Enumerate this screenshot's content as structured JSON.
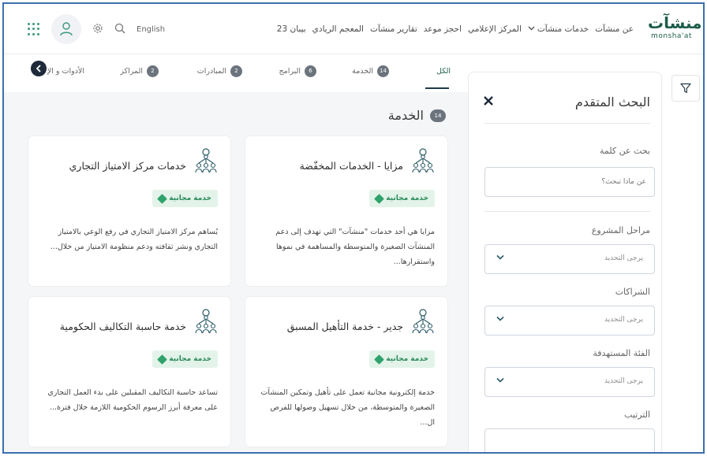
{
  "header": {
    "logo_ar": "منشآت",
    "logo_en": "monsha'at",
    "nav": [
      "عن منشآت",
      "خدمات منشآت",
      "المركز الإعلامي",
      "احجز موعد",
      "تقارير منشآت",
      "المعجم الريادي",
      "بيبان 23"
    ],
    "language": "English"
  },
  "tabs": [
    {
      "label": "الكل",
      "count": ""
    },
    {
      "label": "الخدمة",
      "count": "14"
    },
    {
      "label": "البرامج",
      "count": "6"
    },
    {
      "label": "المبادرات",
      "count": "2"
    },
    {
      "label": "المراكز",
      "count": "2"
    },
    {
      "label": "الأدوات و الإ",
      "count": ""
    }
  ],
  "section": {
    "title": "الخدمة",
    "count": "14"
  },
  "cards": [
    {
      "title": "مزايا - الخدمات المخفّضة",
      "badge": "خدمة مجانية",
      "description": "مزايا هي أحد خدمات \"منشآت\" التي تهدف إلى دعم المنشآت الصغيرة والمتوسطة والمساهمة في نموها واستقرارها..."
    },
    {
      "title": "خدمات مركز الامتياز التجاري",
      "badge": "خدمة مجانية",
      "description": "يُساهم مركز الامتياز التجاري في رفع الوعي بالامتياز التجاري ونشر ثقافته ودعم منظومة الامتياز من خلال..."
    },
    {
      "title": "جدير - خدمة التأهيل المسبق",
      "badge": "خدمة مجانية",
      "description": "خدمة إلكترونية مجانية تعمل على تأهيل وتمكين المنشآت الصغيرة والمتوسطة، من خلال تسهيل وصولها للفرص ال..."
    },
    {
      "title": "خدمة حاسبة التكاليف الحكومية",
      "badge": "خدمة مجانية",
      "description": "تساعد حاسبة التكاليف المقبلين على بدء العمل التجاري على معرفة أبرز الرسوم الحكومية اللازمة خلال فترة..."
    }
  ],
  "advanced_search": {
    "title": "البحث المتقدم",
    "keyword_label": "بحث عن كلمة",
    "keyword_placeholder": "عن ماذا تبحث؟",
    "filters": [
      {
        "label": "مراحل المشروع",
        "placeholder": "يرجى التحديد"
      },
      {
        "label": "الشراكات",
        "placeholder": "يرجى التحديد"
      },
      {
        "label": "الفئة المستهدفة",
        "placeholder": "يرجى التحديد"
      }
    ],
    "sort_label": "الترتيب"
  },
  "colors": {
    "brand": "#1d5d4b",
    "badge_bg": "#e3f3ea",
    "badge_text": "#2a8a5a",
    "scroll_accent": "#2c5f8a",
    "dark": "#1e2a3a"
  }
}
